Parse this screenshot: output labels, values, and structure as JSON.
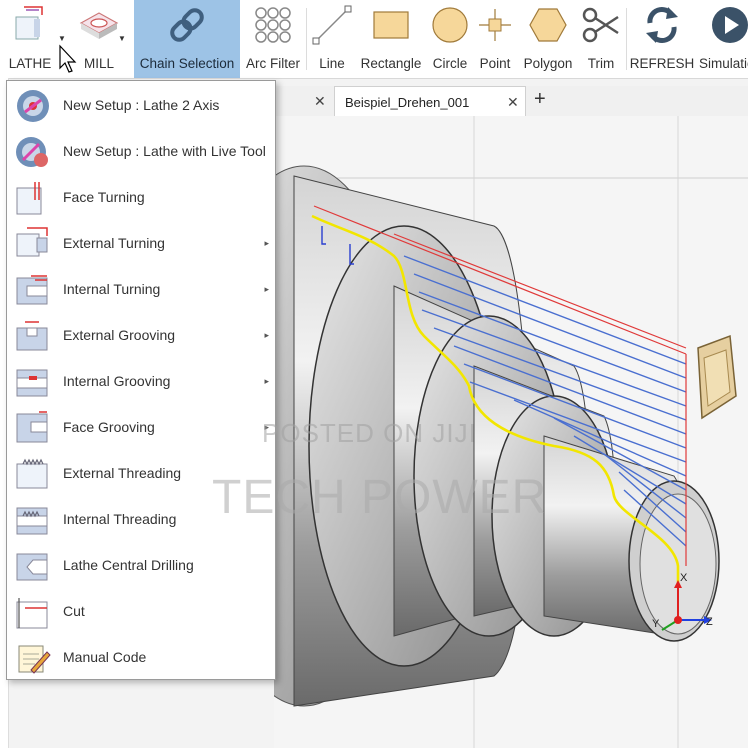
{
  "toolbar": {
    "buttons": [
      {
        "label": "LATHE",
        "icon": "lathe-icon"
      },
      {
        "label": "MILL",
        "icon": "mill-icon"
      },
      {
        "label": "Chain Selection",
        "icon": "chain-icon"
      },
      {
        "label": "Arc Filter",
        "icon": "arc-filter-icon"
      },
      {
        "label": "Line",
        "icon": "line-icon"
      },
      {
        "label": "Rectangle",
        "icon": "rectangle-icon"
      },
      {
        "label": "Circle",
        "icon": "circle-icon"
      },
      {
        "label": "Point",
        "icon": "point-icon"
      },
      {
        "label": "Polygon",
        "icon": "polygon-icon"
      },
      {
        "label": "Trim",
        "icon": "scissors-icon"
      },
      {
        "label": "REFRESH",
        "icon": "refresh-icon"
      },
      {
        "label": "Simulatio",
        "icon": "play-icon"
      }
    ]
  },
  "tabs": {
    "items": [
      {
        "label": ""
      },
      {
        "label": "Beispiel_Drehen_001"
      }
    ],
    "close_glyph": "✕",
    "add_glyph": "+"
  },
  "menu": {
    "items": [
      {
        "label": "New Setup : Lathe 2 Axis",
        "submenu": false
      },
      {
        "label": "New Setup : Lathe with Live Tool",
        "submenu": false
      },
      {
        "label": "Face Turning",
        "submenu": false
      },
      {
        "label": "External Turning",
        "submenu": true
      },
      {
        "label": "Internal Turning",
        "submenu": true
      },
      {
        "label": "External Grooving",
        "submenu": true
      },
      {
        "label": "Internal Grooving",
        "submenu": true
      },
      {
        "label": "Face Grooving",
        "submenu": true
      },
      {
        "label": "External Threading",
        "submenu": false
      },
      {
        "label": "Internal Threading",
        "submenu": false
      },
      {
        "label": "Lathe Central Drilling",
        "submenu": false
      },
      {
        "label": "Cut",
        "submenu": false
      },
      {
        "label": "Manual Code",
        "submenu": false
      }
    ],
    "submenu_glyph": "▸"
  },
  "axes": {
    "x": "X",
    "y": "Y",
    "z": "Z"
  },
  "watermark": {
    "line1": "POSTED ON JIJI",
    "line2": "TECH POWER"
  },
  "colors": {
    "accent": "#9dc3e6",
    "toolpath": "#f2e600",
    "passes": "#4a6fd0",
    "rapid": "#e03a3a"
  }
}
